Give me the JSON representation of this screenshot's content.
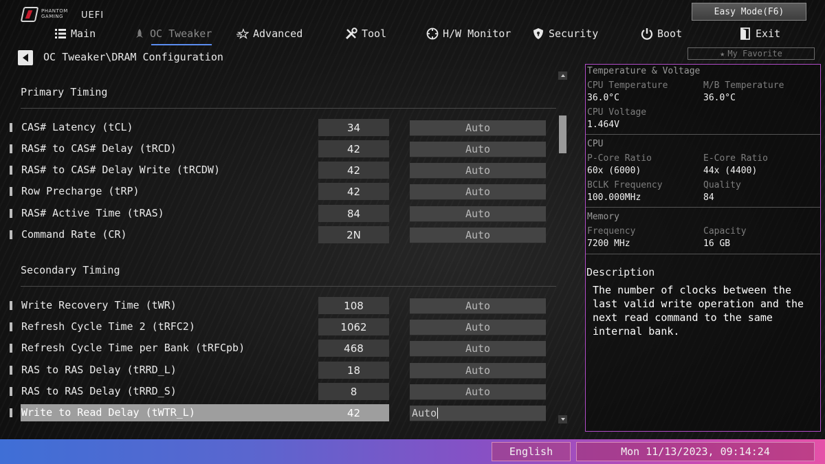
{
  "header": {
    "brand_small": "PHANTOM GAMING",
    "brand_title": "UEFI",
    "easy_mode_label": "Easy Mode(F6)"
  },
  "nav": {
    "items": [
      {
        "label": "Main",
        "icon": "list-icon",
        "active": false
      },
      {
        "label": "OC Tweaker",
        "icon": "rocket-icon",
        "active": true
      },
      {
        "label": "Advanced",
        "icon": "star-icon",
        "active": false
      },
      {
        "label": "Tool",
        "icon": "tools-icon",
        "active": false
      },
      {
        "label": "H/W Monitor",
        "icon": "monitor-icon",
        "active": false
      },
      {
        "label": "Security",
        "icon": "shield-icon",
        "active": false
      },
      {
        "label": "Boot",
        "icon": "power-icon",
        "active": false
      },
      {
        "label": "Exit",
        "icon": "exit-icon",
        "active": false
      }
    ]
  },
  "breadcrumb": "OC Tweaker\\DRAM Configuration",
  "favorite_label": "My Favorite",
  "sections": {
    "primary": {
      "title": "Primary Timing",
      "rows": [
        {
          "label": "CAS# Latency (tCL)",
          "value": "34",
          "option": "Auto"
        },
        {
          "label": "RAS# to CAS# Delay (tRCD)",
          "value": "42",
          "option": "Auto"
        },
        {
          "label": "RAS# to CAS# Delay Write (tRCDW)",
          "value": "42",
          "option": "Auto"
        },
        {
          "label": "Row Precharge (tRP)",
          "value": "42",
          "option": "Auto"
        },
        {
          "label": "RAS# Active Time (tRAS)",
          "value": "84",
          "option": "Auto"
        },
        {
          "label": "Command Rate (CR)",
          "value": "2N",
          "option": "Auto"
        }
      ]
    },
    "secondary": {
      "title": "Secondary Timing",
      "rows": [
        {
          "label": "Write Recovery Time (tWR)",
          "value": "108",
          "option": "Auto"
        },
        {
          "label": "Refresh Cycle Time 2 (tRFC2)",
          "value": "1062",
          "option": "Auto"
        },
        {
          "label": "Refresh Cycle Time per Bank (tRFCpb)",
          "value": "468",
          "option": "Auto"
        },
        {
          "label": "RAS to RAS Delay (tRRD_L)",
          "value": "18",
          "option": "Auto"
        },
        {
          "label": "RAS to RAS Delay (tRRD_S)",
          "value": "8",
          "option": "Auto"
        },
        {
          "label": "Write to Read Delay (tWTR_L)",
          "value": "42",
          "option": "Auto",
          "selected": true
        }
      ]
    }
  },
  "info_panel": {
    "temp_voltage": {
      "title": "Temperature & Voltage",
      "cpu_temp_label": "CPU Temperature",
      "cpu_temp_value": "36.0°C",
      "mb_temp_label": "M/B Temperature",
      "mb_temp_value": "36.0°C",
      "cpu_voltage_label": "CPU Voltage",
      "cpu_voltage_value": "1.464V"
    },
    "cpu": {
      "title": "CPU",
      "pcore_label": "P-Core Ratio",
      "pcore_value": "60x (6000)",
      "ecore_label": "E-Core Ratio",
      "ecore_value": "44x (4400)",
      "bclk_label": "BCLK Frequency",
      "bclk_value": "100.000MHz",
      "quality_label": "Quality",
      "quality_value": "84"
    },
    "memory": {
      "title": "Memory",
      "freq_label": "Frequency",
      "freq_value": "7200 MHz",
      "cap_label": "Capacity",
      "cap_value": "16 GB"
    },
    "description": {
      "title": "Description",
      "text": "The number of clocks between the last valid write operation and the next read command to the same internal bank."
    }
  },
  "footer": {
    "language": "English",
    "datetime": "Mon 11/13/2023, 09:14:24"
  },
  "colors": {
    "accent_blue": "#5b8df0",
    "panel_border": "#b24cc9",
    "bottom_gradient_start": "#3f6fd6",
    "bottom_gradient_end": "#e451a8"
  }
}
